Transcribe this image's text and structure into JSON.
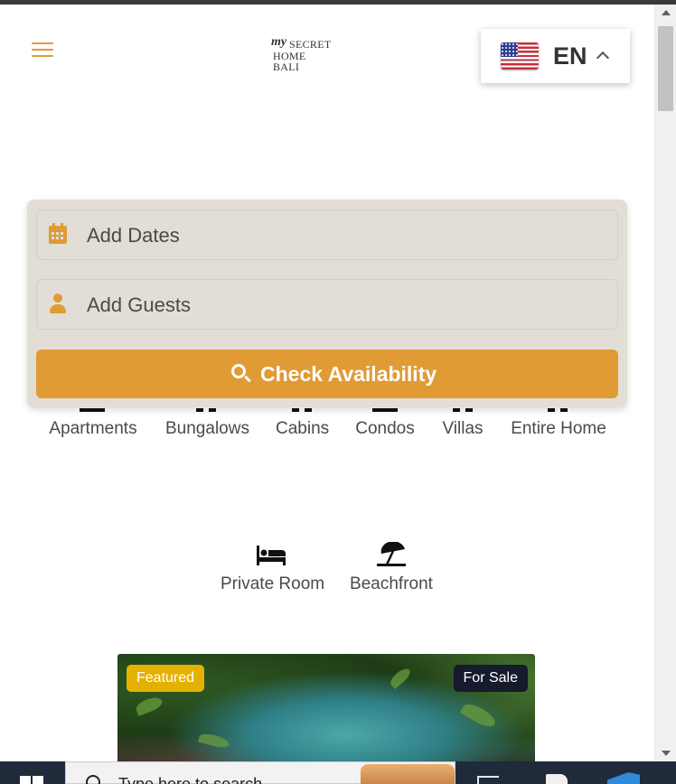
{
  "header": {
    "menu_icon": "hamburger-menu-icon",
    "logo": {
      "script": "my",
      "line1": "SECRET",
      "line2": "HOME BALI"
    },
    "language": {
      "code": "EN",
      "flag": "us-flag",
      "caret_icon": "chevron-up-icon"
    }
  },
  "search": {
    "dates_label": "Add Dates",
    "dates_icon": "calendar-icon",
    "guests_label": "Add Guests",
    "guests_icon": "user-icon",
    "button_label": "Check Availability",
    "button_icon": "search-icon"
  },
  "categories": [
    {
      "label": "Apartments"
    },
    {
      "label": "Bungalows"
    },
    {
      "label": "Cabins"
    },
    {
      "label": "Condos"
    },
    {
      "label": "Villas"
    },
    {
      "label": "Entire Home"
    }
  ],
  "amenities": [
    {
      "label": "Private Room",
      "icon": "bed-icon"
    },
    {
      "label": "Beachfront",
      "icon": "beach-umbrella-icon"
    }
  ],
  "listing": {
    "featured_badge": "Featured",
    "status_badge": "For Sale"
  },
  "taskbar": {
    "search_placeholder": "Type here to search"
  },
  "colors": {
    "accent": "#e09b35",
    "card_bg": "#e2ddd5",
    "featured": "#e5b100",
    "for_sale": "#151a2c"
  }
}
